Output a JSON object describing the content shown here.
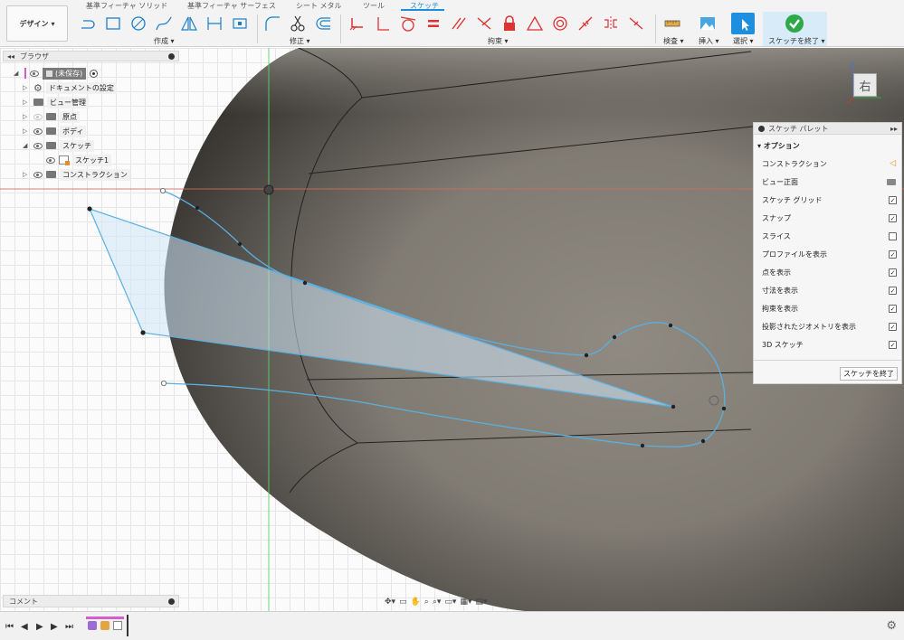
{
  "app": {
    "workspace_button": "デザイン",
    "tabs": [
      "基準フィーチャ ソリッド",
      "基準フィーチャ サーフェス",
      "シート メタル",
      "ツール",
      "スケッチ"
    ],
    "active_tab": "スケッチ"
  },
  "toolbar": {
    "groups": {
      "create": "作成",
      "modify": "修正",
      "constraints": "拘束",
      "inspect": "検査",
      "insert": "挿入",
      "select": "選択",
      "finish": "スケッチを終了"
    },
    "icons": [
      "line-icon",
      "rectangle-icon",
      "circle-icon",
      "spline-icon",
      "mirror-icon",
      "dimension-icon",
      "project-icon",
      "fillet-icon",
      "scissors-icon",
      "offset-icon",
      "fix-icon",
      "coincident-icon",
      "tangent-icon",
      "equal-icon",
      "parallel-icon",
      "perpendicular-icon",
      "lock-icon",
      "triangle-icon",
      "concentric-icon",
      "midpoint-icon",
      "symmetry-icon",
      "curvature-icon",
      "measure-icon",
      "image-icon",
      "cursor-icon",
      "checkmark-icon"
    ]
  },
  "browser": {
    "title": "ブラウザ",
    "items": [
      {
        "label": "(未保存)",
        "level": 0
      },
      {
        "label": "ドキュメントの設定",
        "level": 1
      },
      {
        "label": "ビュー管理",
        "level": 1
      },
      {
        "label": "原点",
        "level": 1
      },
      {
        "label": "ボディ",
        "level": 1
      },
      {
        "label": "スケッチ",
        "level": 1
      },
      {
        "label": "スケッチ1",
        "level": 2
      },
      {
        "label": "コンストラクション",
        "level": 1
      }
    ]
  },
  "palette": {
    "title": "スケッチ パレット",
    "section": "オプション",
    "options": [
      {
        "label": "コンストラクション",
        "control": "icon"
      },
      {
        "label": "ビュー正面",
        "control": "icon"
      },
      {
        "label": "スケッチ グリッド",
        "checked": true
      },
      {
        "label": "スナップ",
        "checked": true
      },
      {
        "label": "スライス",
        "checked": false
      },
      {
        "label": "プロファイルを表示",
        "checked": true
      },
      {
        "label": "点を表示",
        "checked": true
      },
      {
        "label": "寸法を表示",
        "checked": true
      },
      {
        "label": "拘束を表示",
        "checked": true
      },
      {
        "label": "投影されたジオメトリを表示",
        "checked": true
      },
      {
        "label": "3D スケッチ",
        "checked": true
      }
    ],
    "finish_button": "スケッチを終了"
  },
  "viewcube": {
    "face": "右",
    "axis_label": "Z"
  },
  "comments": {
    "label": "コメント"
  },
  "colors": {
    "accent": "#1c8fdc",
    "sketch_line": "#5ab0e0",
    "body": "#7d7870",
    "finish_green": "#2fa84a"
  }
}
